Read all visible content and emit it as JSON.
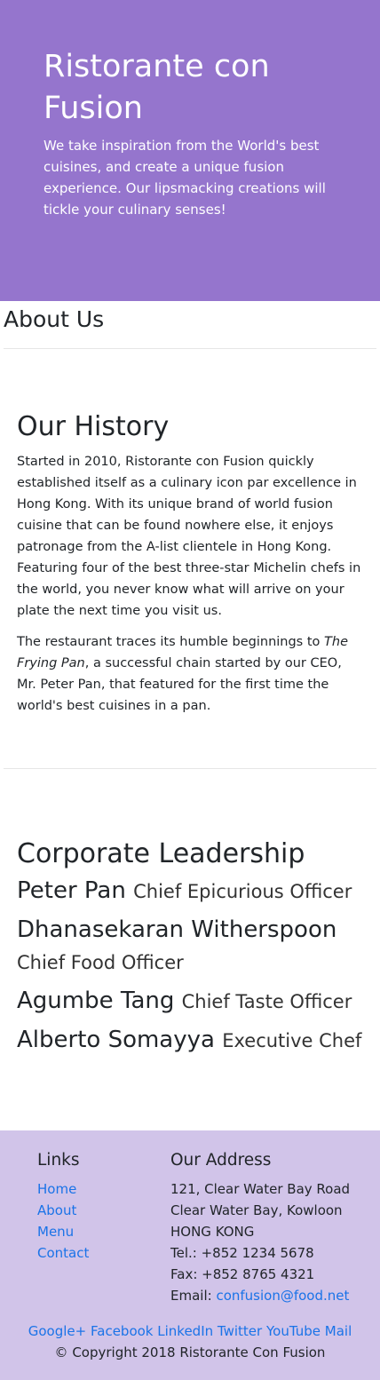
{
  "hero": {
    "title": "Ristorante con Fusion",
    "tagline": "We take inspiration from the World's best cuisines, and create a unique fusion experience. Our lipsmacking creations will tickle your culinary senses!"
  },
  "page": {
    "title": "About Us"
  },
  "history": {
    "heading": "Our History",
    "para1": "Started in 2010, Ristorante con Fusion quickly established itself as a culinary icon par excellence in Hong Kong. With its unique brand of world fusion cuisine that can be found nowhere else, it enjoys patronage from the A-list clientele in Hong Kong. Featuring four of the best three-star Michelin chefs in the world, you never know what will arrive on your plate the next time you visit us.",
    "para2_before": "The restaurant traces its humble beginnings to ",
    "para2_italic": "The Frying Pan",
    "para2_after": ", a successful chain started by our CEO, Mr. Peter Pan, that featured for the first time the world's best cuisines in a pan."
  },
  "leadership": {
    "heading": "Corporate Leadership",
    "leaders": [
      {
        "name": "Peter Pan",
        "role": "Chief Epicurious Officer"
      },
      {
        "name": "Dhanasekaran Witherspoon",
        "role": "Chief Food Officer"
      },
      {
        "name": "Agumbe Tang",
        "role": "Chief Taste Officer"
      },
      {
        "name": "Alberto Somayya",
        "role": "Executive Chef"
      }
    ]
  },
  "footer": {
    "links_heading": "Links",
    "links": [
      "Home",
      "About",
      "Menu",
      "Contact"
    ],
    "address_heading": "Our Address",
    "address_lines": [
      "121, Clear Water Bay Road",
      "Clear Water Bay, Kowloon",
      "HONG KONG",
      "Tel.: +852 1234 5678",
      "Fax: +852 8765 4321"
    ],
    "email_label": "Email: ",
    "email": "confusion@food.net",
    "social": [
      "Google+",
      "Facebook",
      "LinkedIn",
      "Twitter",
      "YouTube",
      "Mail"
    ],
    "copyright": "© Copyright 2018 Ristorante Con Fusion"
  }
}
